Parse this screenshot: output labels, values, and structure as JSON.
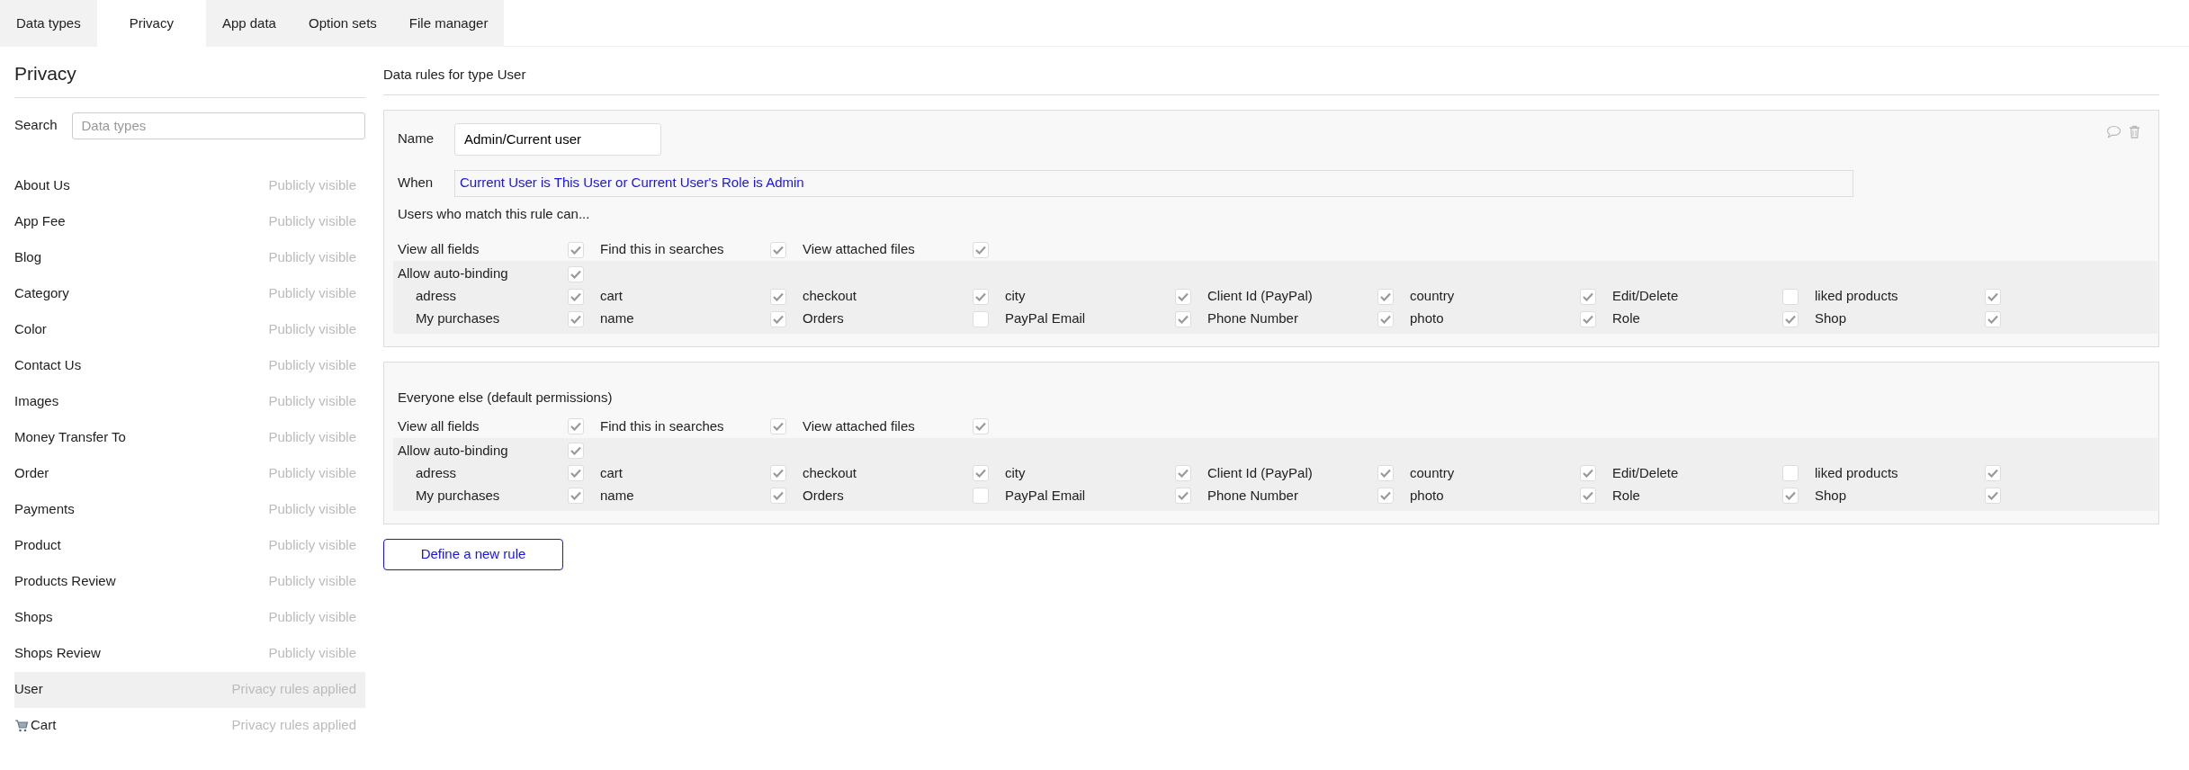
{
  "tabs": [
    {
      "label": "Data types",
      "selected": false
    },
    {
      "label": "Privacy",
      "selected": true
    },
    {
      "label": "App data",
      "selected": false
    },
    {
      "label": "Option sets",
      "selected": false
    },
    {
      "label": "File manager",
      "selected": false
    }
  ],
  "sidebar": {
    "title": "Privacy",
    "search": {
      "label": "Search",
      "placeholder": "Data types"
    },
    "items": [
      {
        "kind": "plain",
        "name": "About Us",
        "status": "Publicly visible",
        "selected": false
      },
      {
        "kind": "plain",
        "name": "App Fee",
        "status": "Publicly visible",
        "selected": false
      },
      {
        "kind": "plain",
        "name": "Blog",
        "status": "Publicly visible",
        "selected": false
      },
      {
        "kind": "plain",
        "name": "Category",
        "status": "Publicly visible",
        "selected": false
      },
      {
        "kind": "plain",
        "name": "Color",
        "status": "Publicly visible",
        "selected": false
      },
      {
        "kind": "plain",
        "name": "Contact Us",
        "status": "Publicly visible",
        "selected": false
      },
      {
        "kind": "plain",
        "name": "Images",
        "status": "Publicly visible",
        "selected": false
      },
      {
        "kind": "plain",
        "name": "Money Transfer To",
        "status": "Publicly visible",
        "selected": false
      },
      {
        "kind": "plain",
        "name": "Order",
        "status": "Publicly visible",
        "selected": false
      },
      {
        "kind": "plain",
        "name": "Payments",
        "status": "Publicly visible",
        "selected": false
      },
      {
        "kind": "plain",
        "name": "Product",
        "status": "Publicly visible",
        "selected": false
      },
      {
        "kind": "plain",
        "name": "Products Review",
        "status": "Publicly visible",
        "selected": false
      },
      {
        "kind": "plain",
        "name": "Shops",
        "status": "Publicly visible",
        "selected": false
      },
      {
        "kind": "plain",
        "name": "Shops Review",
        "status": "Publicly visible",
        "selected": false
      },
      {
        "kind": "plain",
        "name": "User",
        "status": "Privacy rules applied",
        "selected": true
      },
      {
        "kind": "cart",
        "name": "Cart",
        "status": "Privacy rules applied",
        "selected": false
      }
    ]
  },
  "main": {
    "heading": "Data rules for type User",
    "rules": [
      {
        "kind": "custom",
        "name_label": "Name",
        "name_value": "Admin/Current user",
        "when_label": "When",
        "when_value": "Current User is This User or Current User's Role is Admin",
        "intro": "Users who match this rule can...",
        "permissions": [
          {
            "label": "View all fields",
            "checked": true
          },
          {
            "label": "Find this in searches",
            "checked": true
          },
          {
            "label": "View attached files",
            "checked": true
          }
        ],
        "auto_binding": {
          "label": "Allow auto-binding",
          "checked": true
        },
        "fields": [
          {
            "label": "adress",
            "checked": true
          },
          {
            "label": "cart",
            "checked": true
          },
          {
            "label": "checkout",
            "checked": true
          },
          {
            "label": "city",
            "checked": true
          },
          {
            "label": "Client Id (PayPal)",
            "checked": true
          },
          {
            "label": "country",
            "checked": true
          },
          {
            "label": "Edit/Delete",
            "checked": false
          },
          {
            "label": "liked products",
            "checked": true
          },
          {
            "label": "My purchases",
            "checked": true
          },
          {
            "label": "name",
            "checked": true
          },
          {
            "label": "Orders",
            "checked": false
          },
          {
            "label": "PayPal Email",
            "checked": true
          },
          {
            "label": "Phone Number",
            "checked": true
          },
          {
            "label": "photo",
            "checked": true
          },
          {
            "label": "Role",
            "checked": true
          },
          {
            "label": "Shop",
            "checked": true
          }
        ]
      },
      {
        "kind": "default",
        "intro": "Everyone else (default permissions)",
        "permissions": [
          {
            "label": "View all fields",
            "checked": true
          },
          {
            "label": "Find this in searches",
            "checked": true
          },
          {
            "label": "View attached files",
            "checked": true
          }
        ],
        "auto_binding": {
          "label": "Allow auto-binding",
          "checked": true
        },
        "fields": [
          {
            "label": "adress",
            "checked": true
          },
          {
            "label": "cart",
            "checked": true
          },
          {
            "label": "checkout",
            "checked": true
          },
          {
            "label": "city",
            "checked": true
          },
          {
            "label": "Client Id (PayPal)",
            "checked": true
          },
          {
            "label": "country",
            "checked": true
          },
          {
            "label": "Edit/Delete",
            "checked": false
          },
          {
            "label": "liked products",
            "checked": true
          },
          {
            "label": "My purchases",
            "checked": true
          },
          {
            "label": "name",
            "checked": true
          },
          {
            "label": "Orders",
            "checked": false
          },
          {
            "label": "PayPal Email",
            "checked": true
          },
          {
            "label": "Phone Number",
            "checked": true
          },
          {
            "label": "photo",
            "checked": true
          },
          {
            "label": "Role",
            "checked": true
          },
          {
            "label": "Shop",
            "checked": true
          }
        ]
      }
    ],
    "new_rule_button": "Define a new rule"
  }
}
